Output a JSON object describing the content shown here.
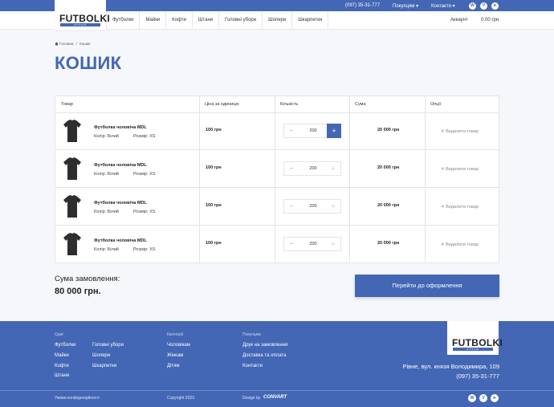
{
  "topbar": {
    "phone": "(097) 35-31-777",
    "buyers": "Покупцям ▾",
    "contacts": "Контакти ▾",
    "social": [
      {
        "icon": "whatsapp-icon",
        "glyph": "W"
      },
      {
        "icon": "viber-icon",
        "glyph": "V"
      },
      {
        "icon": "telegram-icon",
        "glyph": "➤"
      }
    ]
  },
  "header": {
    "logo": "FUTBOLKI",
    "logo_sub": "ОПТОМ",
    "nav": [
      "Футболки",
      "Майки",
      "Кофти",
      "Штани",
      "Головні убори",
      "Шопери",
      "Шкарпетки"
    ],
    "account": "Аккаунт",
    "cart_total": "0.00 грн"
  },
  "breadcrumb": {
    "home": "Головна",
    "separator": "/",
    "current": "Кошик"
  },
  "page_title": "КОШИК",
  "cart": {
    "columns": [
      "Товар",
      "Ціна за одиницю",
      "Кількість",
      "Сума",
      "Опції"
    ],
    "items": [
      {
        "name": "Футболка чоловіча MDL",
        "color": "Колір: Білий",
        "size": "Розмір: XS",
        "price": "100 грн",
        "qty": "200",
        "sum": "20 000 грн",
        "remove": "Видалити товар"
      },
      {
        "name": "Футболка чоловіча MDL",
        "color": "Колір: Білий",
        "size": "Розмір: XS",
        "price": "100 грн",
        "qty": "200",
        "sum": "20 000 грн",
        "remove": "Видалити товар"
      },
      {
        "name": "Футболка чоловіча MDL",
        "color": "Колір: Білий",
        "size": "Розмір: XS",
        "price": "100 грн",
        "qty": "200",
        "sum": "20 000 грн",
        "remove": "Видалити товар"
      },
      {
        "name": "Футболка чоловіча MDL",
        "color": "Колір: Білий",
        "size": "Розмір: XS",
        "price": "100 грн",
        "qty": "200",
        "sum": "20 000 грн",
        "remove": "Видалити товар"
      }
    ]
  },
  "summary": {
    "label": "Сума замовлення:",
    "value": "80 000 грн.",
    "checkout": "Перейти до оформлення"
  },
  "footer": {
    "clothes_heading": "Одяг",
    "clothes_col1": [
      "Футболки",
      "Майки",
      "Кофти",
      "Штани"
    ],
    "clothes_col2": [
      "Головні убори",
      "Шопери",
      "Шкарпетки"
    ],
    "categories_heading": "Категорії",
    "categories": [
      "Чоловікам",
      "Жінкам",
      "Дітям"
    ],
    "buyers_heading": "Покупцям",
    "buyers": [
      "Друк на замовлення",
      "Доставка та оплата",
      "Контакти"
    ],
    "address": "Рівне, вул. князя Володимира, 109",
    "phone": "(097) 35-31-777",
    "privacy": "Умови конфіденційності",
    "copyright": "Copyright 2023",
    "design_by": "Design by",
    "design_brand": "CONVART"
  },
  "colors": {
    "accent": "#4367b5",
    "background": "#f6f7fa"
  }
}
